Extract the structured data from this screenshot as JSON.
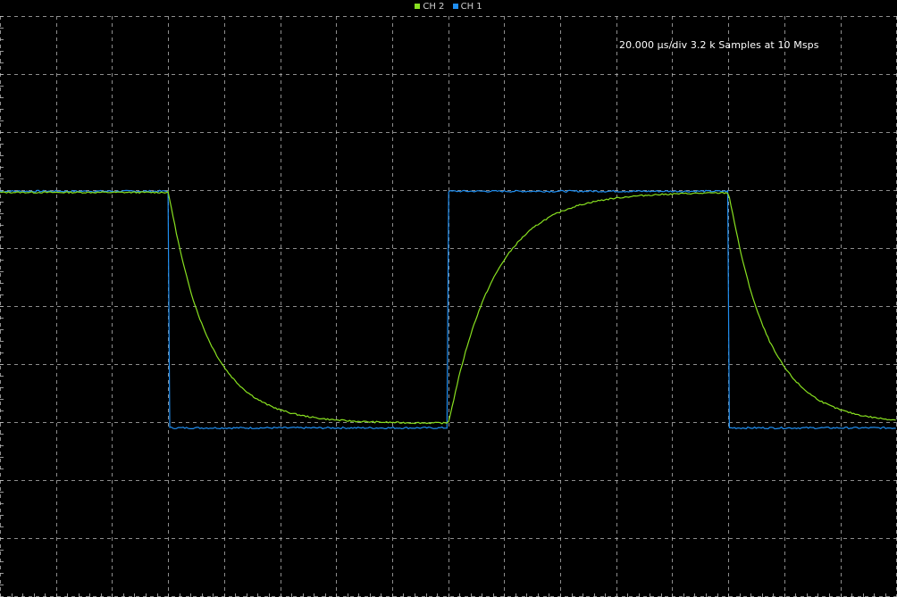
{
  "legend": [
    {
      "label": "CH 2",
      "color": "#88e020"
    },
    {
      "label": "CH 1",
      "color": "#1f8ef0"
    }
  ],
  "readout": "20.000 µs/div 3.2 k Samples at 10 Msps",
  "colors": {
    "background": "#000000",
    "grid": "#bdbdbd",
    "ch1": "#1f8ef0",
    "ch2": "#88e020"
  },
  "chart_data": {
    "type": "line",
    "title": "",
    "xlabel": "",
    "ylabel": "",
    "x_divisions": 16,
    "y_divisions": 10,
    "xlim": [
      0,
      16
    ],
    "ylim": [
      0,
      10
    ],
    "grid": true,
    "legend_placement": "top-center",
    "series": [
      {
        "name": "CH 1",
        "color": "#1f8ef0",
        "shape": "square",
        "period_div": 10.0,
        "first_fall_div": 3.0,
        "high_div": 6.98,
        "low_div": 2.9
      },
      {
        "name": "CH 2",
        "color": "#88e020",
        "shape": "rc_response",
        "period_div": 10.0,
        "first_fall_div": 3.0,
        "high_div": 6.96,
        "low_div": 2.98,
        "overshoot_peak_div": 6.6,
        "undershoot_trough_div": 3.3,
        "tau_div": 0.7
      }
    ]
  }
}
